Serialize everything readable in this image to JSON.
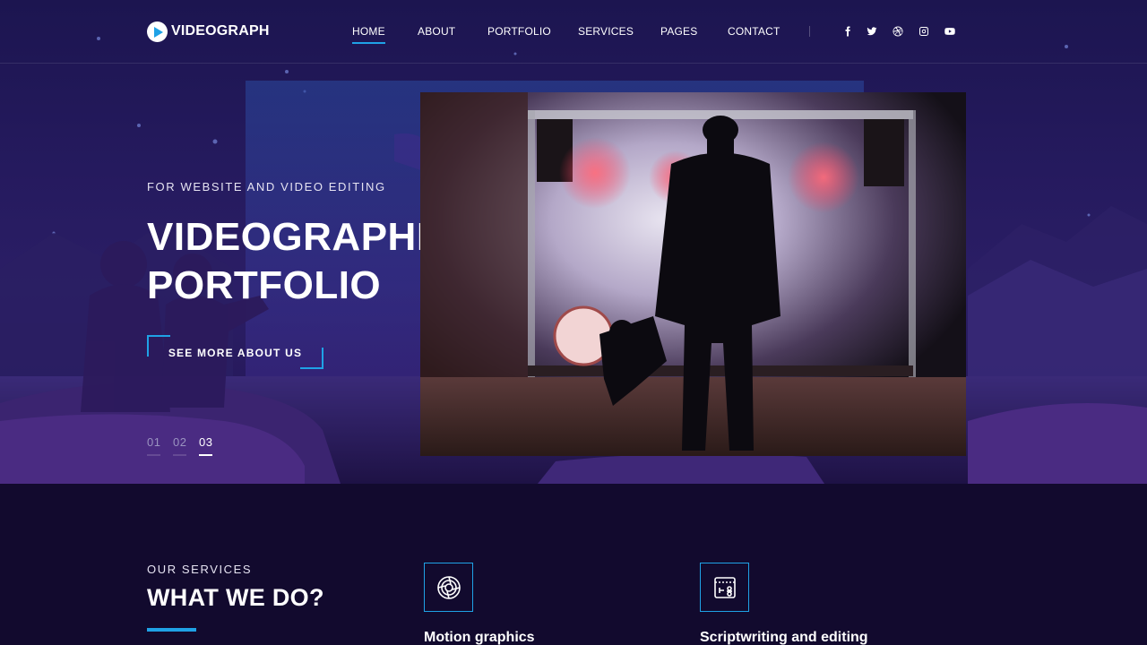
{
  "brand": {
    "name": "VIDEOGRAPH",
    "logo_icon": "play-circle-icon"
  },
  "nav": {
    "items": [
      {
        "label": "HOME",
        "active": true
      },
      {
        "label": "ABOUT",
        "active": false
      },
      {
        "label": "PORTFOLIO",
        "active": false
      },
      {
        "label": "SERVICES",
        "active": false
      },
      {
        "label": "PAGES",
        "active": false
      },
      {
        "label": "CONTACT",
        "active": false
      }
    ],
    "social": [
      "facebook-icon",
      "twitter-icon",
      "dribbble-icon",
      "instagram-icon",
      "youtube-icon"
    ]
  },
  "hero": {
    "eyebrow": "FOR WEBSITE AND VIDEO EDITING",
    "title_line1": "VIDEOGRAPHER’S",
    "title_line2": "PORTFOLIO",
    "cta_label": "SEE MORE ABOUT US",
    "slides": [
      "01",
      "02",
      "03"
    ],
    "active_slide": "03"
  },
  "services": {
    "eyebrow": "OUR SERVICES",
    "title": "WHAT WE DO?",
    "items": [
      {
        "title": "Motion graphics",
        "icon": "film-reel-icon"
      },
      {
        "title": "Scriptwriting and editing",
        "icon": "video-edit-icon"
      }
    ]
  },
  "colors": {
    "accent": "#1fa2e6",
    "background": "#120a2e",
    "hero_bg": "#251a5e"
  }
}
